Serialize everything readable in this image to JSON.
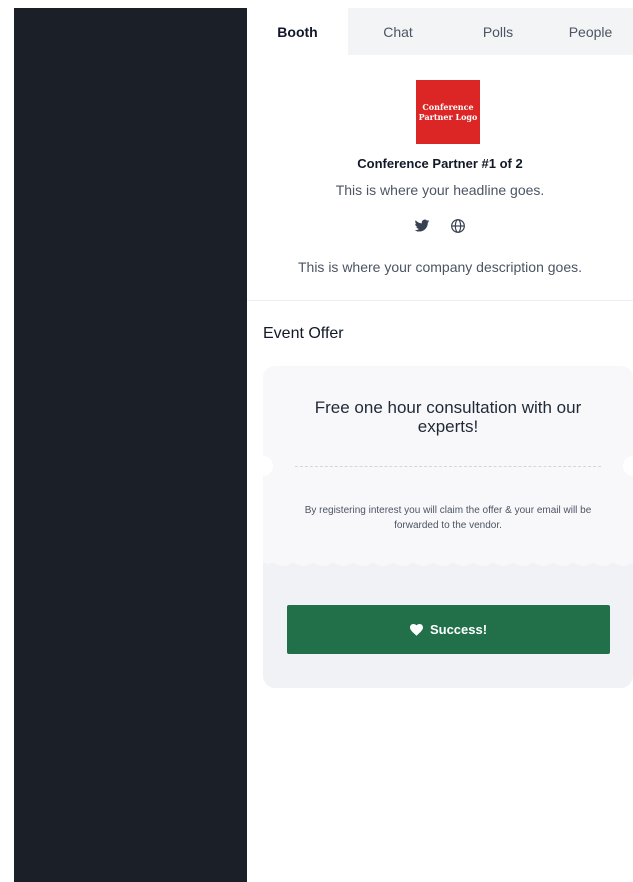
{
  "tabs": [
    {
      "label": "Booth",
      "active": true
    },
    {
      "label": "Chat",
      "active": false
    },
    {
      "label": "Polls",
      "active": false
    },
    {
      "label": "People",
      "active": false
    }
  ],
  "booth": {
    "logo_text": [
      "Conference",
      "Partner Logo"
    ],
    "partner_name": "Conference Partner #1 of 2",
    "headline": "This is where your headline goes.",
    "social_icons": [
      "twitter-icon",
      "globe-icon"
    ],
    "company_description": "This is where your company description goes."
  },
  "offer": {
    "heading": "Event Offer",
    "title": "Free one hour consultation with our experts!",
    "note": "By registering interest you will claim the offer & your email will be forwarded to the vendor.",
    "button_label": "Success!",
    "button_icon": "heart-icon"
  },
  "colors": {
    "dark_pane": "#1b1f28",
    "tab_bar": "#f3f4f6",
    "logo_red": "#dc2626",
    "success_green": "#22704a",
    "card_bg": "#f1f2f5"
  }
}
